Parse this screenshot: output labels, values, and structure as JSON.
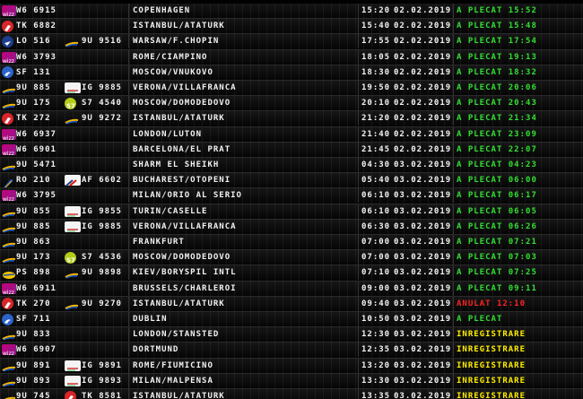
{
  "colors": {
    "status_ok": "#33dd33",
    "status_cancel": "#ff2222",
    "status_checkin": "#ffee00",
    "text": "#f2f2f2"
  },
  "flights": [
    {
      "icon": "wizz-logo",
      "code": "W6 6915",
      "icon2": "",
      "code2": "",
      "destination": "COPENHAGEN",
      "time": "15:20",
      "date": "02.02.2019",
      "status": "A PLECAT 15:52",
      "status_type": "ok"
    },
    {
      "icon": "turkish-logo",
      "code": "TK 6882",
      "icon2": "",
      "code2": "",
      "destination": "ISTANBUL/ATATURK",
      "time": "15:40",
      "date": "02.02.2019",
      "status": "A PLECAT 15:48",
      "status_type": "ok"
    },
    {
      "icon": "lot-logo",
      "code": "LO 516",
      "icon2": "tarom-logo",
      "code2": "9U 9516",
      "destination": "WARSAW/F.CHOPIN",
      "time": "17:55",
      "date": "02.02.2019",
      "status": "A PLECAT 17:54",
      "status_type": "ok"
    },
    {
      "icon": "wizz-logo",
      "code": "W6 3793",
      "icon2": "",
      "code2": "",
      "destination": "ROME/CIAMPINO",
      "time": "18:05",
      "date": "02.02.2019",
      "status": "A PLECAT 19:13",
      "status_type": "ok"
    },
    {
      "icon": "aeroflot-logo",
      "code": "SF 131",
      "icon2": "",
      "code2": "",
      "destination": "MOSCOW/VNUKOVO",
      "time": "18:30",
      "date": "02.02.2019",
      "status": "A PLECAT 18:32",
      "status_type": "ok"
    },
    {
      "icon": "tarom-logo",
      "code": "9U 885",
      "icon2": "alitalia-logo",
      "code2": "IG 9885",
      "destination": "VERONA/VILLAFRANCA",
      "time": "19:50",
      "date": "02.02.2019",
      "status": "A PLECAT 20:06",
      "status_type": "ok"
    },
    {
      "icon": "tarom-logo",
      "code": "9U 175",
      "icon2": "s7-logo",
      "code2": "S7 4540",
      "destination": "MOSCOW/DOMODEDOVO",
      "time": "20:10",
      "date": "02.02.2019",
      "status": "A PLECAT 20:43",
      "status_type": "ok"
    },
    {
      "icon": "turkish-logo",
      "code": "TK 272",
      "icon2": "tarom-logo",
      "code2": "9U 9272",
      "destination": "ISTANBUL/ATATURK",
      "time": "21:20",
      "date": "02.02.2019",
      "status": "A PLECAT 21:34",
      "status_type": "ok"
    },
    {
      "icon": "wizz-logo",
      "code": "W6 6937",
      "icon2": "",
      "code2": "",
      "destination": "LONDON/LUTON",
      "time": "21:40",
      "date": "02.02.2019",
      "status": "A PLECAT 23:09",
      "status_type": "ok"
    },
    {
      "icon": "wizz-logo",
      "code": "W6 6901",
      "icon2": "",
      "code2": "",
      "destination": "BARCELONA/EL PRAT",
      "time": "21:45",
      "date": "02.02.2019",
      "status": "A PLECAT 22:07",
      "status_type": "ok"
    },
    {
      "icon": "tarom-logo",
      "code": "9U 5471",
      "icon2": "",
      "code2": "",
      "destination": "SHARM EL SHEIKH",
      "time": "04:30",
      "date": "03.02.2019",
      "status": "A PLECAT 04:23",
      "status_type": "ok"
    },
    {
      "icon": "tarom-ro-logo",
      "code": "RO 210",
      "icon2": "airfrance-logo",
      "code2": "AF 6602",
      "destination": "BUCHAREST/OTOPENI",
      "time": "05:40",
      "date": "03.02.2019",
      "status": "A PLECAT 06:00",
      "status_type": "ok"
    },
    {
      "icon": "wizz-logo",
      "code": "W6 3795",
      "icon2": "",
      "code2": "",
      "destination": "MILAN/ORIO AL SERIO",
      "time": "06:10",
      "date": "03.02.2019",
      "status": "A PLECAT 06:17",
      "status_type": "ok"
    },
    {
      "icon": "tarom-logo",
      "code": "9U 855",
      "icon2": "alitalia-logo",
      "code2": "IG 9855",
      "destination": "TURIN/CASELLE",
      "time": "06:10",
      "date": "03.02.2019",
      "status": "A PLECAT 06:05",
      "status_type": "ok"
    },
    {
      "icon": "tarom-logo",
      "code": "9U 885",
      "icon2": "alitalia-logo",
      "code2": "IG 9885",
      "destination": "VERONA/VILLAFRANCA",
      "time": "06:30",
      "date": "03.02.2019",
      "status": "A PLECAT 06:26",
      "status_type": "ok"
    },
    {
      "icon": "tarom-logo",
      "code": "9U 863",
      "icon2": "",
      "code2": "",
      "destination": "FRANKFURT",
      "time": "07:00",
      "date": "03.02.2019",
      "status": "A PLECAT 07:21",
      "status_type": "ok"
    },
    {
      "icon": "tarom-logo",
      "code": "9U 173",
      "icon2": "s7-logo",
      "code2": "S7 4536",
      "destination": "MOSCOW/DOMODEDOVO",
      "time": "07:00",
      "date": "03.02.2019",
      "status": "A PLECAT 07:03",
      "status_type": "ok"
    },
    {
      "icon": "ukraine-logo",
      "code": "PS 898",
      "icon2": "tarom-logo",
      "code2": "9U 9898",
      "destination": "KIEV/BORYSPIL INTL",
      "time": "07:10",
      "date": "03.02.2019",
      "status": "A PLECAT 07:25",
      "status_type": "ok"
    },
    {
      "icon": "wizz-logo",
      "code": "W6 6911",
      "icon2": "",
      "code2": "",
      "destination": "BRUSSELS/CHARLEROI",
      "time": "09:00",
      "date": "03.02.2019",
      "status": "A PLECAT 09:11",
      "status_type": "ok"
    },
    {
      "icon": "turkish-logo",
      "code": "TK 270",
      "icon2": "tarom-logo",
      "code2": "9U 9270",
      "destination": "ISTANBUL/ATATURK",
      "time": "09:40",
      "date": "03.02.2019",
      "status": "ANULAT 12:10",
      "status_type": "cancel"
    },
    {
      "icon": "aeroflot-logo",
      "code": "SF 711",
      "icon2": "",
      "code2": "",
      "destination": "DUBLIN",
      "time": "10:50",
      "date": "03.02.2019",
      "status": "A PLECAT",
      "status_type": "ok"
    },
    {
      "icon": "tarom-logo",
      "code": "9U 833",
      "icon2": "",
      "code2": "",
      "destination": "LONDON/STANSTED",
      "time": "12:30",
      "date": "03.02.2019",
      "status": "INREGISTRARE",
      "status_type": "checkin"
    },
    {
      "icon": "wizz-logo",
      "code": "W6 6907",
      "icon2": "",
      "code2": "",
      "destination": "DORTMUND",
      "time": "12:35",
      "date": "03.02.2019",
      "status": "INREGISTRARE",
      "status_type": "checkin"
    },
    {
      "icon": "tarom-logo",
      "code": "9U 891",
      "icon2": "alitalia-logo",
      "code2": "IG 9891",
      "destination": "ROME/FIUMICINO",
      "time": "13:20",
      "date": "03.02.2019",
      "status": "INREGISTRARE",
      "status_type": "checkin"
    },
    {
      "icon": "tarom-logo",
      "code": "9U 893",
      "icon2": "alitalia-logo",
      "code2": "IG 9893",
      "destination": "MILAN/MALPENSA",
      "time": "13:30",
      "date": "03.02.2019",
      "status": "INREGISTRARE",
      "status_type": "checkin"
    },
    {
      "icon": "tarom-logo",
      "code": "9U 745",
      "icon2": "turkish-logo",
      "code2": "TK 8581",
      "destination": "ISTANBUL/ATATURK",
      "time": "13:35",
      "date": "03.02.2019",
      "status": "INREGISTRARE",
      "status_type": "checkin"
    }
  ]
}
